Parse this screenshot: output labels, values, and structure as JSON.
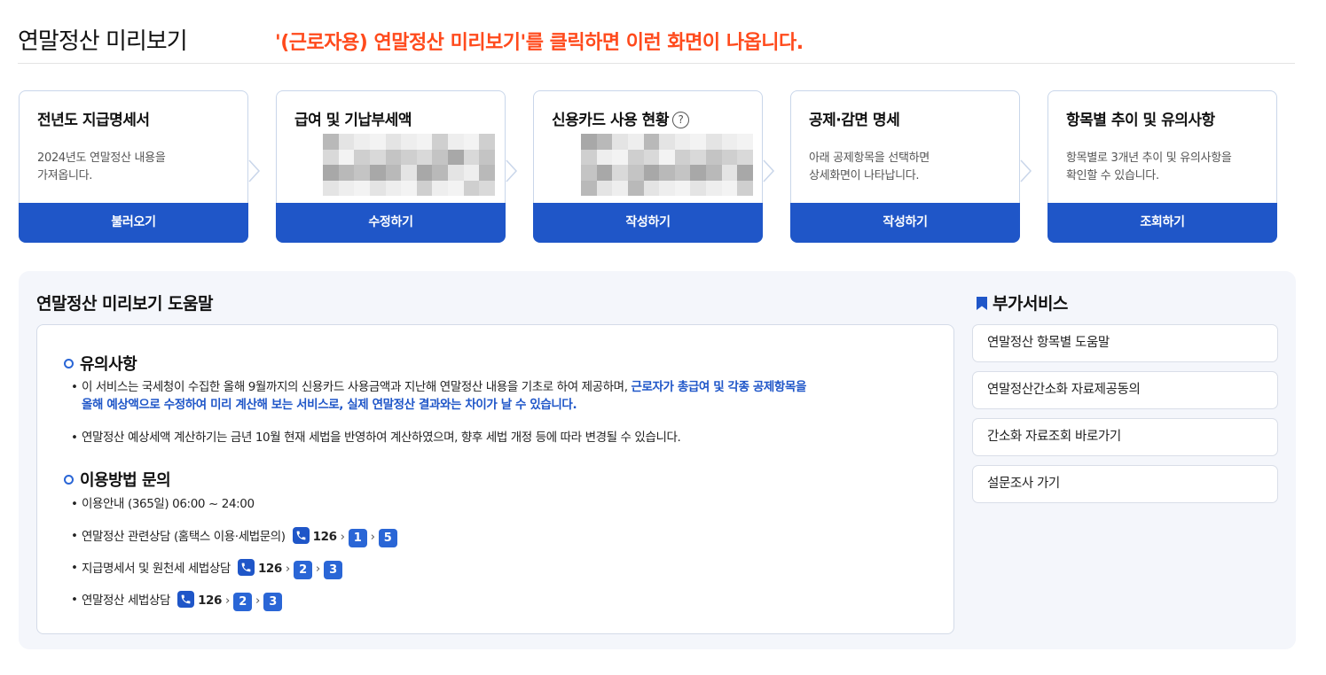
{
  "header": {
    "title": "연말정산 미리보기",
    "annotation": "'(근로자용) 연말정산 미리보기'를 클릭하면 이런 화면이 나옵니다."
  },
  "steps": [
    {
      "title": "전년도 지급명세서",
      "desc": "2024년도 연말정산 내용을\n가져옵니다.",
      "button": "불러오기"
    },
    {
      "title": "급여 및 기납부세액",
      "desc": "",
      "button": "수정하기"
    },
    {
      "title": "신용카드 사용 현황",
      "help": "?",
      "desc": "",
      "button": "작성하기"
    },
    {
      "title": "공제·감면 명세",
      "desc": "아래 공제항목을 선택하면\n상세화면이 나타납니다.",
      "button": "작성하기"
    },
    {
      "title": "항목별 추이 및 유의사항",
      "desc": "항목별로 3개년 추이 및 유의사항을\n확인할 수 있습니다.",
      "button": "조회하기"
    }
  ],
  "help": {
    "title": "연말정산 미리보기 도움말",
    "notice": {
      "heading": "유의사항",
      "bullet1_plain": "이 서비스는 국세청이 수집한 올해 9월까지의 신용카드 사용금액과 지난해 연말정산 내용을 기초로 하여 제공하며, ",
      "bullet1_blue_a": "근로자가 총급여 및 각종 공제항목을",
      "bullet1_blue_b": "올해 예상액으로 수정하여 미리 계산해 보는 서비스로, 실제 연말정산 결과와는 차이가 날 수 있습니다.",
      "bullet2": "연말정산 예상세액 계산하기는 금년 10월 현재 세법을 반영하여 계산하였으며, 향후 세법 개정 등에 따라 변경될 수 있습니다."
    },
    "contact": {
      "heading": "이용방법 문의",
      "hours": "이용안내 (365일) 06:00 ~ 24:00",
      "lines": [
        {
          "label": "연말정산 관련상담 (홈택스 이용·세법문의)",
          "number": "126",
          "keys": [
            "1",
            "5"
          ]
        },
        {
          "label": "지급명세서 및 원천세 세법상담",
          "number": "126",
          "keys": [
            "2",
            "3"
          ]
        },
        {
          "label": "연말정산 세법상담",
          "number": "126",
          "keys": [
            "2",
            "3"
          ]
        }
      ]
    }
  },
  "extra": {
    "title": "부가서비스",
    "items": [
      "연말정산 항목별 도움말",
      "연말정산간소화 자료제공동의",
      "간소화 자료조회 바로가기",
      "설문조사 가기"
    ]
  },
  "colors": {
    "primary": "#1f56c8",
    "annotation": "#ff4a1c",
    "panel_bg": "#f4f6fb"
  }
}
